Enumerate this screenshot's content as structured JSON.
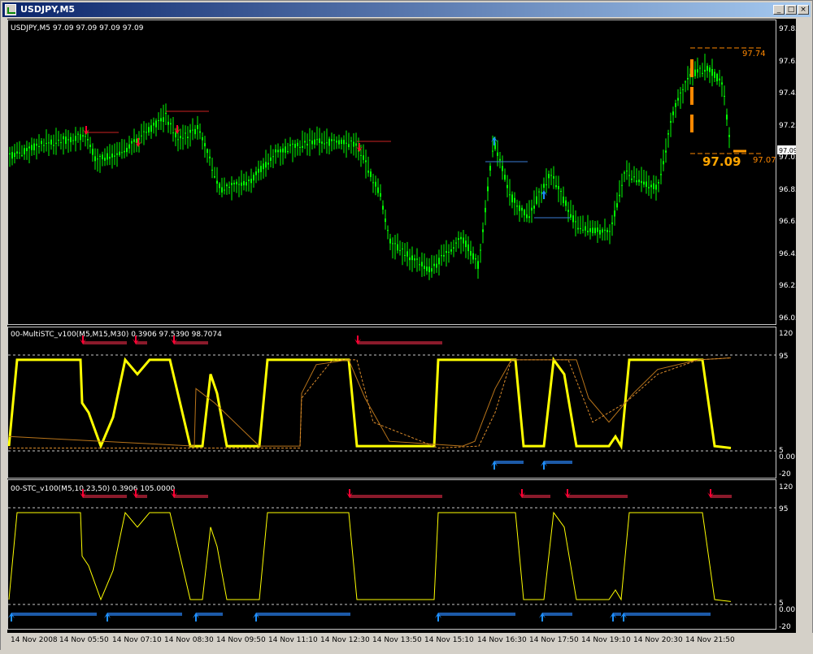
{
  "window": {
    "title": "USDJPY,M5",
    "minimize": "_",
    "restore": "□",
    "close": "×"
  },
  "main_pane": {
    "header": "USDJPY,M5  97.09 97.09 97.09 97.09",
    "price_labels": [
      "97.85",
      "97.65",
      "97.45",
      "97.25",
      "97.05",
      "96.85",
      "96.65",
      "96.45",
      "96.25",
      "96.05"
    ],
    "current_price_box": "97.09",
    "big_price": "97.09",
    "level_high": "97.74",
    "level_low": "97.07"
  },
  "multistc_pane": {
    "header": "00-MultiSTC_v100(M5,M15,M30) 0.3906 97.5390 98.7074",
    "levels": [
      "120",
      "95",
      "5",
      "0.00",
      "-20"
    ]
  },
  "stc_pane": {
    "header": "00-STC_v100(M5,10,23,50) 0.3906 105.0000",
    "levels": [
      "120",
      "95",
      "5",
      "0.00",
      "-20"
    ]
  },
  "time_axis": [
    "14 Nov 2008",
    "14 Nov 05:50",
    "14 Nov 07:10",
    "14 Nov 08:30",
    "14 Nov 09:50",
    "14 Nov 11:10",
    "14 Nov 12:30",
    "14 Nov 13:50",
    "14 Nov 15:10",
    "14 Nov 16:30",
    "14 Nov 17:50",
    "14 Nov 19:10",
    "14 Nov 20:30",
    "14 Nov 21:50"
  ],
  "colors": {
    "candle": "#00ff00",
    "stc": "#ffff00",
    "sell_arrow": "#ff0033",
    "buy_arrow": "#1e90ff",
    "sell_bar": "#8b1a2b",
    "buy_bar": "#1c5aa8",
    "grid": "#c8c8c8",
    "level_line": "#ff8800"
  }
}
